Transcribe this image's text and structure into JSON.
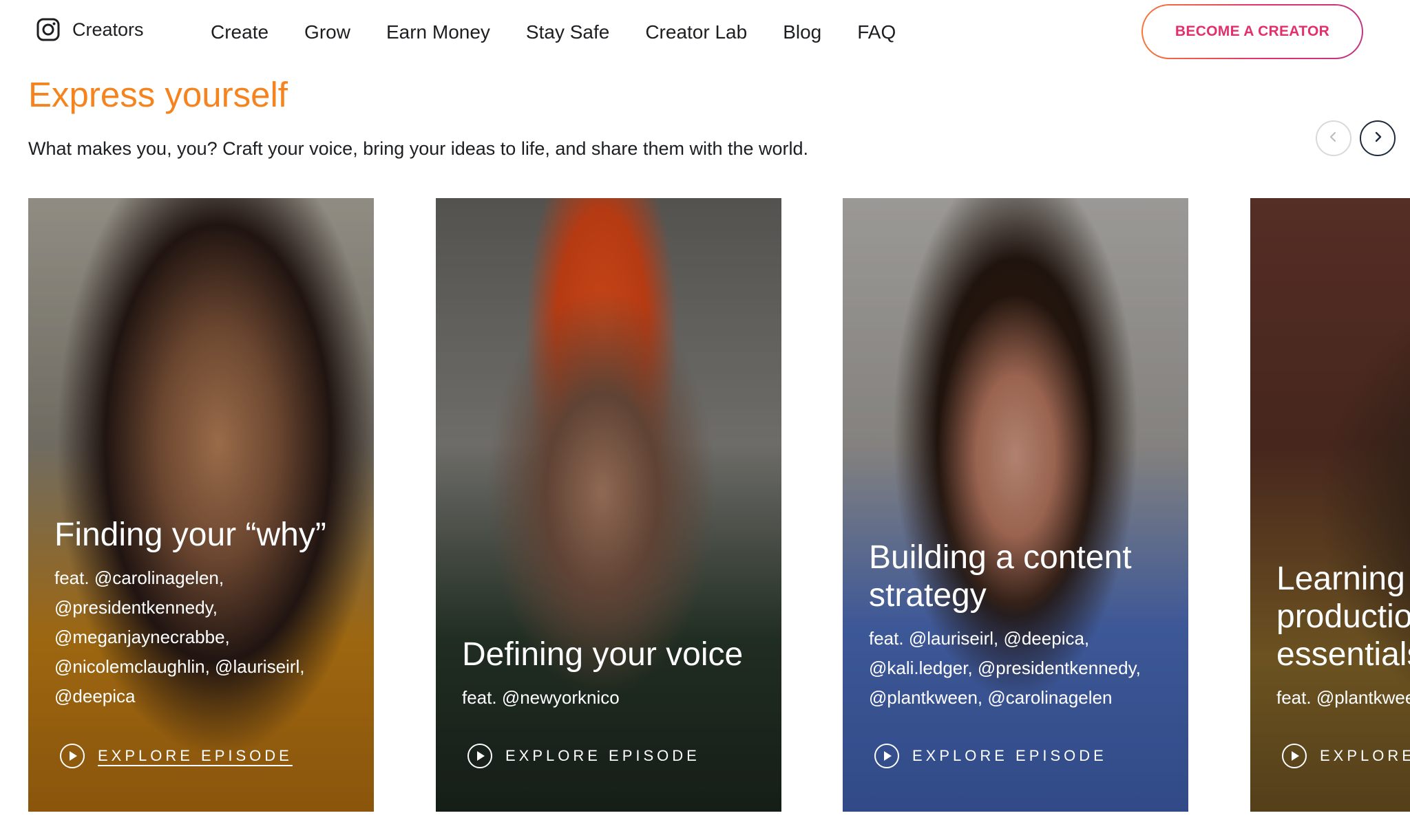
{
  "header": {
    "logo_icon": "instagram-icon",
    "logo_text": "Creators",
    "nav": [
      "Create",
      "Grow",
      "Earn Money",
      "Stay Safe",
      "Creator Lab",
      "Blog",
      "FAQ"
    ],
    "cta_label": "BECOME A CREATOR"
  },
  "section": {
    "title": "Express yourself",
    "subtitle": "What makes you, you? Craft your voice, bring your ideas to life, and share them with the world.",
    "prev_icon": "chevron-left-icon",
    "next_icon": "chevron-right-icon"
  },
  "cards": [
    {
      "title": "Finding your “why”",
      "feat": "feat. @carolinagelen, @presidentkennedy, @meganjaynecrabbe, @nicolemclaughlin, @lauriseirl, @deepica",
      "cta": "EXPLORE EPISODE"
    },
    {
      "title": "Defining your voice",
      "feat": "feat. @newyorknico",
      "cta": "EXPLORE EPISODE"
    },
    {
      "title": "Building a content strategy",
      "feat": "feat. @lauriseirl, @deepica, @kali.ledger, @presidentkennedy, @plantkween, @carolinagelen",
      "cta": "EXPLORE EPISODE"
    },
    {
      "title": "Learning production essentials",
      "feat": "feat. @plantkween",
      "cta": "EXPLORE EPISODE"
    }
  ],
  "colors": {
    "accent_orange": "#f5841f",
    "cta_pink": "#e1306c"
  }
}
